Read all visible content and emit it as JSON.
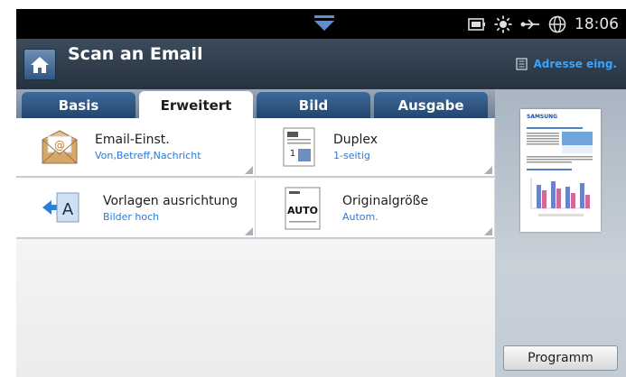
{
  "status_bar": {
    "time": "18:06",
    "icons": [
      "pull-down-arrow-icon",
      "toner-icon",
      "light-icon",
      "connection-icon",
      "network-icon"
    ]
  },
  "header": {
    "title": "Scan an Email",
    "home_icon": "home-icon",
    "address_label": "Adresse eing.",
    "address_icon": "address-book-icon"
  },
  "tabs": [
    {
      "label": "Basis",
      "active": false
    },
    {
      "label": "Erweitert",
      "active": true
    },
    {
      "label": "Bild",
      "active": false
    },
    {
      "label": "Ausgabe",
      "active": false
    }
  ],
  "tiles": [
    {
      "label": "Email-Einst.",
      "sub": "Von,Betreff,Nachricht",
      "icon": "email-envelope-icon"
    },
    {
      "label": "Duplex",
      "sub": "1-seitig",
      "icon": "duplex-page-icon"
    },
    {
      "label": "Vorlagen ausrichtung",
      "sub": "Bilder hoch",
      "icon": "orientation-icon",
      "icon_text": "A"
    },
    {
      "label": "Originalgröße",
      "sub": "Autom.",
      "icon": "original-size-icon",
      "icon_text": "AUTO"
    }
  ],
  "preview": {
    "icon": "document-preview-thumbnail",
    "brand_text": "SAMSUNG"
  },
  "program_button": "Programm",
  "colors": {
    "accent_blue": "#2a7bd6",
    "tab_blue": "#2f5686",
    "header_dark": "#2b3744"
  }
}
